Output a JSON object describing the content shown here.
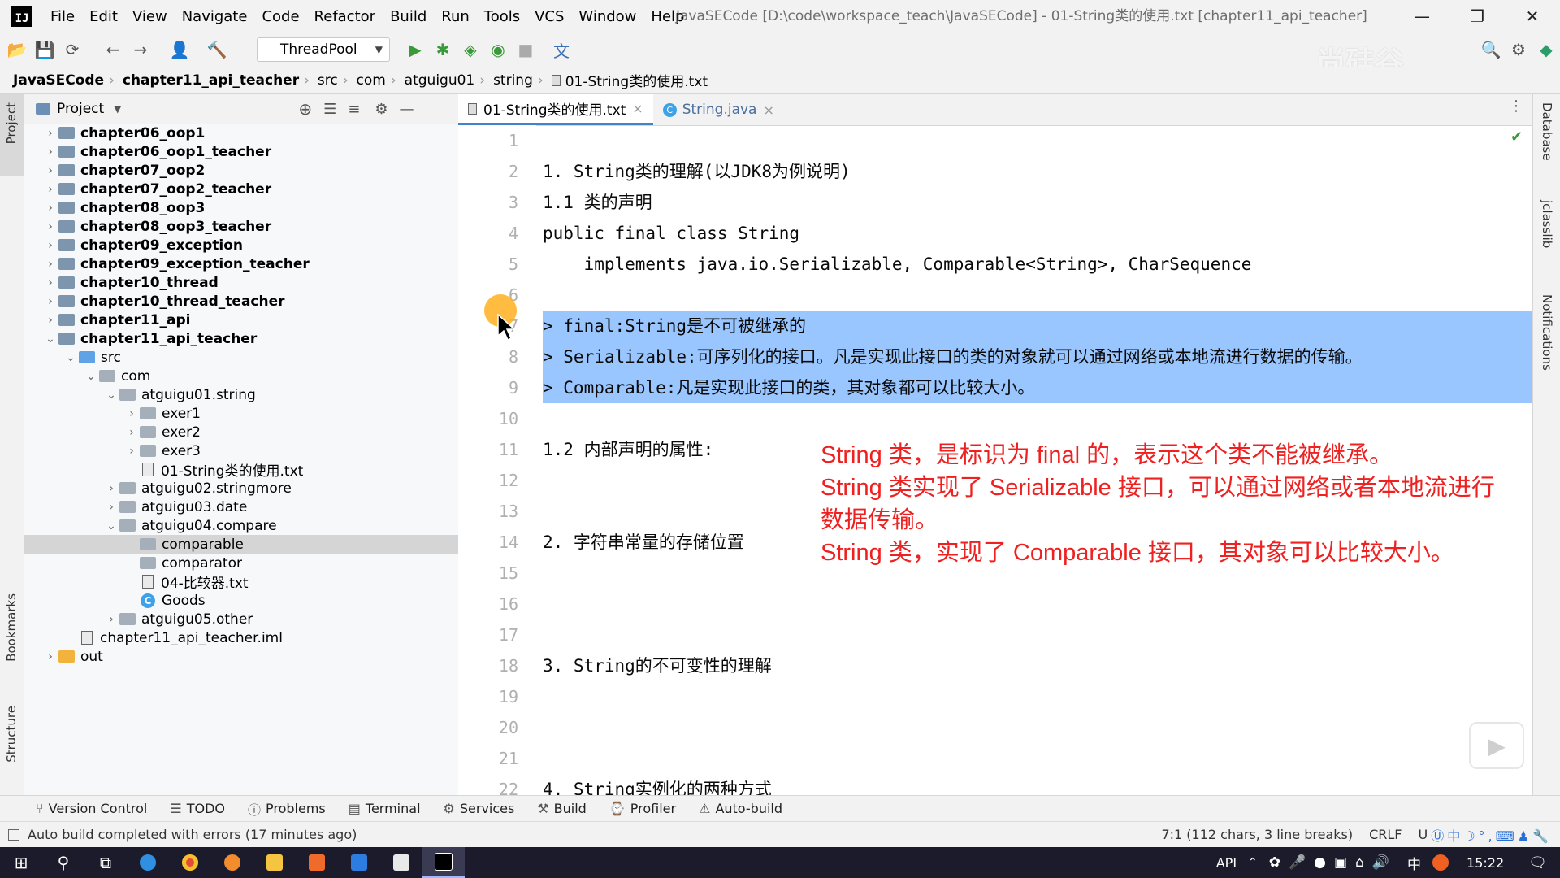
{
  "menubar": {
    "items": [
      "File",
      "Edit",
      "View",
      "Navigate",
      "Code",
      "Refactor",
      "Build",
      "Run",
      "Tools",
      "VCS",
      "Window",
      "Help"
    ],
    "title": "JavaSECode [D:\\code\\workspace_teach\\JavaSECode] - 01-String类的使用.txt [chapter11_api_teacher]",
    "app_icon": "IJ"
  },
  "toolbar": {
    "run_config": "ThreadPool",
    "watermark": "尚硅谷"
  },
  "breadcrumb": [
    "JavaSECode",
    "chapter11_api_teacher",
    "src",
    "com",
    "atguigu01",
    "string",
    "01-String类的使用.txt"
  ],
  "left_stripe": {
    "project": "Project",
    "bookmarks": "Bookmarks",
    "structure": "Structure"
  },
  "right_stripe": {
    "database": "Database",
    "jclasslib": "jclasslib",
    "notifications": "Notifications"
  },
  "project_panel": {
    "title": "Project",
    "tree": [
      {
        "label": "chapter06_oop1",
        "type": "module",
        "depth": 0,
        "expanded": false
      },
      {
        "label": "chapter06_oop1_teacher",
        "type": "module",
        "depth": 0,
        "expanded": false
      },
      {
        "label": "chapter07_oop2",
        "type": "module",
        "depth": 0,
        "expanded": false
      },
      {
        "label": "chapter07_oop2_teacher",
        "type": "module",
        "depth": 0,
        "expanded": false
      },
      {
        "label": "chapter08_oop3",
        "type": "module",
        "depth": 0,
        "expanded": false
      },
      {
        "label": "chapter08_oop3_teacher",
        "type": "module",
        "depth": 0,
        "expanded": false
      },
      {
        "label": "chapter09_exception",
        "type": "module",
        "depth": 0,
        "expanded": false
      },
      {
        "label": "chapter09_exception_teacher",
        "type": "module",
        "depth": 0,
        "expanded": false
      },
      {
        "label": "chapter10_thread",
        "type": "module",
        "depth": 0,
        "expanded": false
      },
      {
        "label": "chapter10_thread_teacher",
        "type": "module",
        "depth": 0,
        "expanded": false
      },
      {
        "label": "chapter11_api",
        "type": "module",
        "depth": 0,
        "expanded": false
      },
      {
        "label": "chapter11_api_teacher",
        "type": "module",
        "depth": 0,
        "expanded": true
      },
      {
        "label": "src",
        "type": "src",
        "depth": 1,
        "expanded": true
      },
      {
        "label": "com",
        "type": "pkg",
        "depth": 2,
        "expanded": true
      },
      {
        "label": "atguigu01.string",
        "type": "pkg",
        "depth": 3,
        "expanded": true
      },
      {
        "label": "exer1",
        "type": "pkg",
        "depth": 4,
        "expanded": false
      },
      {
        "label": "exer2",
        "type": "pkg",
        "depth": 4,
        "expanded": false
      },
      {
        "label": "exer3",
        "type": "pkg",
        "depth": 4,
        "expanded": false
      },
      {
        "label": "01-String类的使用.txt",
        "type": "file",
        "depth": 4
      },
      {
        "label": "atguigu02.stringmore",
        "type": "pkg",
        "depth": 3,
        "expanded": false
      },
      {
        "label": "atguigu03.date",
        "type": "pkg",
        "depth": 3,
        "expanded": false
      },
      {
        "label": "atguigu04.compare",
        "type": "pkg",
        "depth": 3,
        "expanded": true
      },
      {
        "label": "comparable",
        "type": "pkg",
        "depth": 4,
        "selected": true
      },
      {
        "label": "comparator",
        "type": "pkg",
        "depth": 4
      },
      {
        "label": "04-比较器.txt",
        "type": "file",
        "depth": 4
      },
      {
        "label": "Goods",
        "type": "class",
        "depth": 4
      },
      {
        "label": "atguigu05.other",
        "type": "pkg",
        "depth": 3,
        "expanded": false
      },
      {
        "label": "chapter11_api_teacher.iml",
        "type": "file",
        "depth": 1
      },
      {
        "label": "out",
        "type": "out",
        "depth": 0,
        "expanded": false
      }
    ]
  },
  "editor": {
    "tabs": [
      {
        "label": "01-String类的使用.txt",
        "active": true
      },
      {
        "label": "String.java",
        "active": false
      }
    ],
    "line_numbers": [
      "1",
      "2",
      "3",
      "4",
      "5",
      "6",
      "7",
      "8",
      "9",
      "10",
      "11",
      "12",
      "13",
      "14",
      "15",
      "16",
      "17",
      "18",
      "19",
      "20",
      "21",
      "22"
    ],
    "lines": {
      "2": "1. String类的理解(以JDK8为例说明)",
      "3": "1.1 类的声明",
      "4": "public final class String",
      "5": "    implements java.io.Serializable, Comparable<String>, CharSequence",
      "7": "> final:String是不可被继承的",
      "8": "> Serializable:可序列化的接口。凡是实现此接口的类的对象就可以通过网络或本地流进行数据的传输。",
      "9": "> Comparable:凡是实现此接口的类，其对象都可以比较大小。",
      "11": "1.2 内部声明的属性:",
      "14": "2. 字符串常量的存储位置",
      "18": "3. String的不可变性的理解",
      "22": "4. String实例化的两种方式"
    },
    "selected_lines": [
      7,
      9
    ],
    "annotation": [
      "String 类，是标识为 final 的，表示这个类不能被继承。",
      "String 类实现了 Serializable 接口，可以通过网络或者本地流进行",
      "数据传输。",
      "String 类，实现了 Comparable 接口，其对象可以比较大小。"
    ],
    "annotation_color": "#ef2020",
    "selection_color": "#99c6ff"
  },
  "tool_tabs": [
    "Version Control",
    "TODO",
    "Problems",
    "Terminal",
    "Services",
    "Build",
    "Profiler",
    "Auto-build"
  ],
  "statusbar": {
    "message": "Auto build completed with errors (17 minutes ago)",
    "position": "7:1 (112 chars, 3 line breaks)",
    "line_sep": "CRLF",
    "encoding": "U"
  },
  "taskbar": {
    "api_label": "API",
    "ime": "中",
    "time": "15:22"
  }
}
